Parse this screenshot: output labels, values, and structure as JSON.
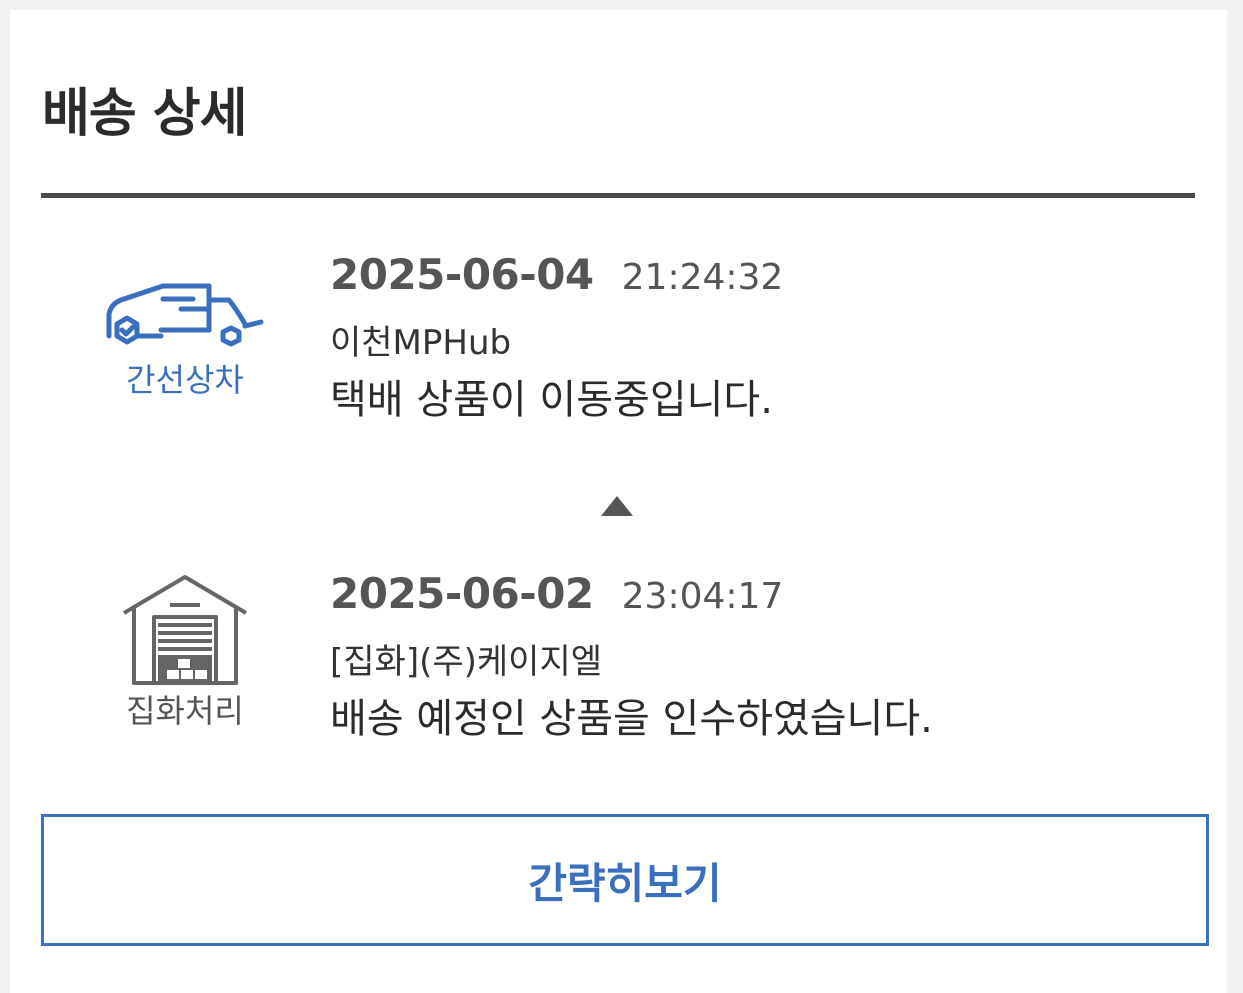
{
  "header": {
    "title": "배송 상세"
  },
  "events": [
    {
      "icon": "truck-icon",
      "status": "간선상차",
      "date": "2025-06-04",
      "time": "21:24:32",
      "location": "이천MPHub",
      "message": "택배 상품이 이동중입니다.",
      "accent": "#3a6fbe"
    },
    {
      "icon": "warehouse-icon",
      "status": "집화처리",
      "date": "2025-06-02",
      "time": "23:04:17",
      "location": "[집화](주)케이지엘",
      "message": "배송 예정인 상품을 인수하였습니다.",
      "accent": "#555555"
    }
  ],
  "toggle_button": {
    "label": "간략히보기",
    "color": "#3a6fbe"
  }
}
